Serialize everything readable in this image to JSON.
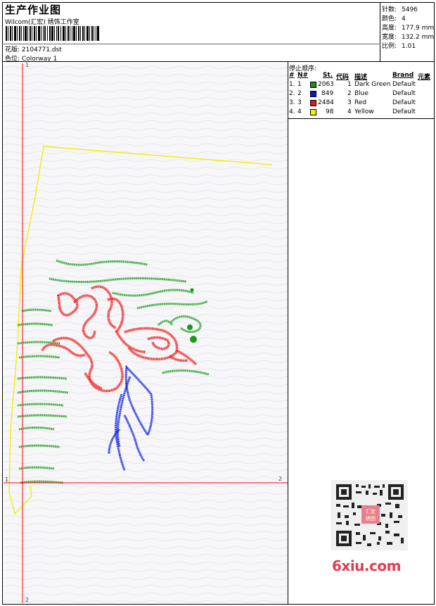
{
  "header": {
    "title": "生产作业图",
    "company": "Wilcom(汇宏) 绣饰工作室",
    "design_label": "花版:",
    "design_value": "2104771.dst",
    "colorway_label": "色位:",
    "colorway_value": "Colorway 1"
  },
  "stats": [
    {
      "label": "针数:",
      "value": "5496"
    },
    {
      "label": "颜色:",
      "value": "4"
    },
    {
      "label": "高度:",
      "value": "177.9 mm"
    },
    {
      "label": "宽度:",
      "value": "132.2 mm"
    },
    {
      "label": "比例:",
      "value": "1.01"
    }
  ],
  "stop_sequence": {
    "title": "停止顺序:",
    "columns": [
      "#",
      "N#",
      "St.",
      "代码",
      "描述",
      "Brand",
      "元素"
    ],
    "rows": [
      {
        "index": "1.",
        "n": "1",
        "color": "#1a8a1a",
        "stitches": "2063",
        "code": "1",
        "desc": "Dark Green",
        "brand": "Default"
      },
      {
        "index": "2.",
        "n": "2",
        "color": "#0a14d8",
        "stitches": "849",
        "code": "2",
        "desc": "Blue",
        "brand": "Default"
      },
      {
        "index": "3.",
        "n": "3",
        "color": "#e01818",
        "stitches": "2484",
        "code": "3",
        "desc": "Red",
        "brand": "Default"
      },
      {
        "index": "4.",
        "n": "4",
        "color": "#f4f000",
        "stitches": "98",
        "code": "4",
        "desc": "Yellow",
        "brand": "Default"
      }
    ]
  },
  "axes": {
    "x_start": "1",
    "x_end": "2",
    "y_start": "1",
    "y_end": "2"
  },
  "thread_colors": {
    "green": "#1a9a1a",
    "blue": "#1020e0",
    "red": "#ee1a1a",
    "yellow": "#f0ee00",
    "axis": "#ff0000"
  },
  "watermark": {
    "site": "6xiu.com",
    "stamp": "汇宏绣图"
  }
}
